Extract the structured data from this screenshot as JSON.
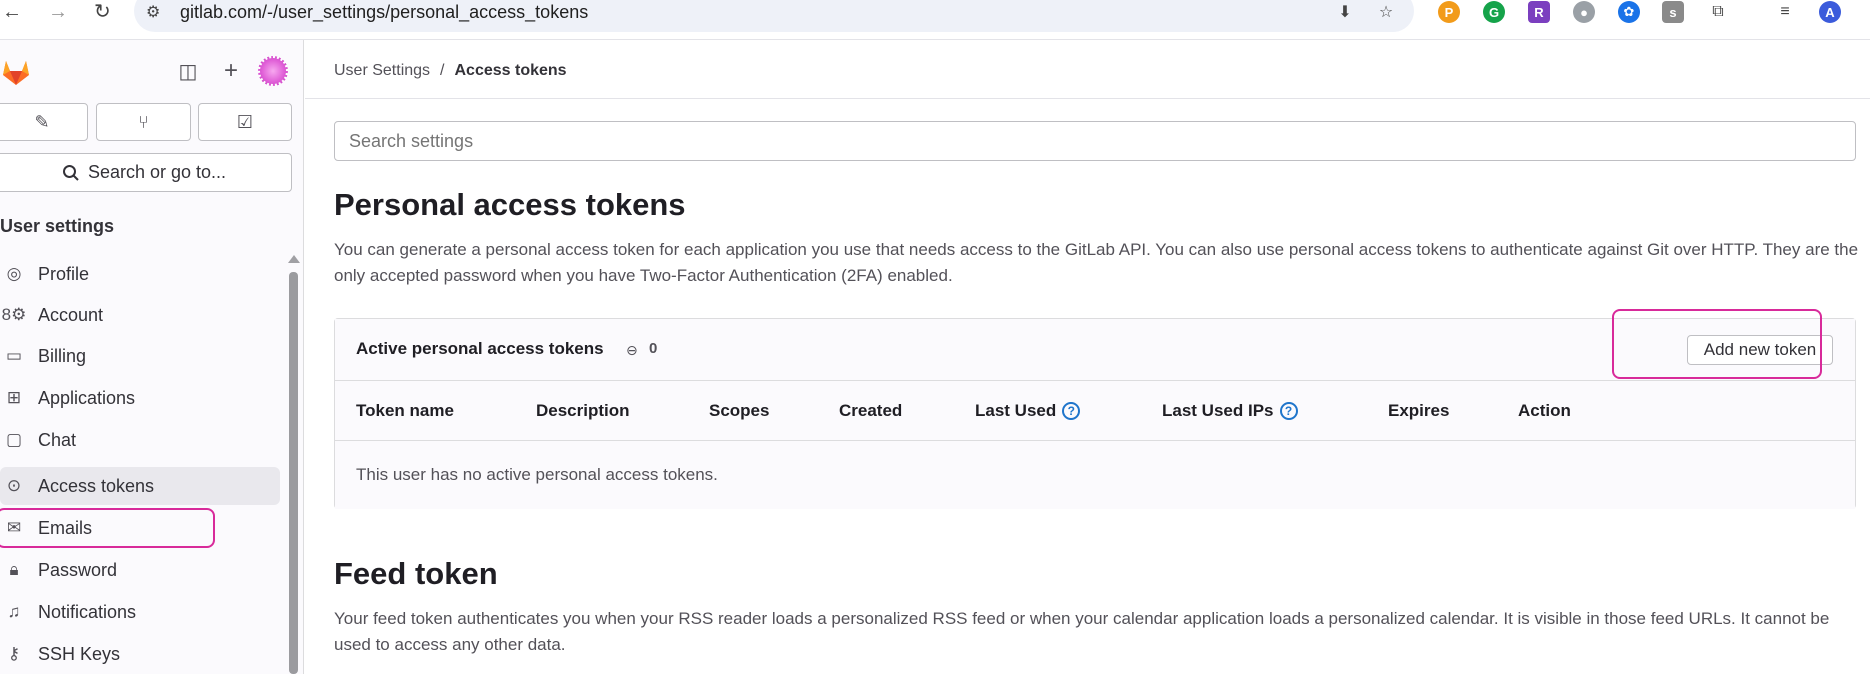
{
  "browser": {
    "url": "gitlab.com/-/user_settings/personal_access_tokens"
  },
  "sidebar": {
    "search_label": "Search or go to...",
    "section_title": "User settings",
    "items": [
      {
        "label": "Profile",
        "icon": "profile-icon"
      },
      {
        "label": "Account",
        "icon": "account-icon"
      },
      {
        "label": "Billing",
        "icon": "billing-icon"
      },
      {
        "label": "Applications",
        "icon": "applications-icon"
      },
      {
        "label": "Chat",
        "icon": "chat-icon"
      },
      {
        "label": "Access tokens",
        "icon": "token-icon",
        "active": true
      },
      {
        "label": "Emails",
        "icon": "mail-icon"
      },
      {
        "label": "Password",
        "icon": "lock-icon"
      },
      {
        "label": "Notifications",
        "icon": "bell-icon"
      },
      {
        "label": "SSH Keys",
        "icon": "key-icon"
      }
    ]
  },
  "breadcrumb": {
    "parent": "User Settings",
    "separator": "/",
    "current": "Access tokens"
  },
  "search": {
    "placeholder": "Search settings"
  },
  "pat_section": {
    "title": "Personal access tokens",
    "description": "You can generate a personal access token for each application you use that needs access to the GitLab API. You can also use personal access tokens to authenticate against Git over HTTP. They are the only accepted password when you have Two-Factor Authentication (2FA) enabled."
  },
  "token_card": {
    "title": "Active personal access tokens",
    "count": "0",
    "add_button": "Add new token",
    "columns": [
      "Token name",
      "Description",
      "Scopes",
      "Created",
      "Last Used",
      "Last Used IPs",
      "Expires",
      "Action"
    ],
    "empty_text": "This user has no active personal access tokens."
  },
  "feed_section": {
    "title": "Feed token",
    "description": "Your feed token authenticates you when your RSS reader loads a personalized RSS feed or when your calendar application loads a personalized calendar. It is visible in those feed URLs. It cannot be used to access any other data."
  },
  "colors": {
    "highlight": "#d82a9a",
    "link_blue": "#1f75cb",
    "active_bg": "#e9e8ed"
  }
}
